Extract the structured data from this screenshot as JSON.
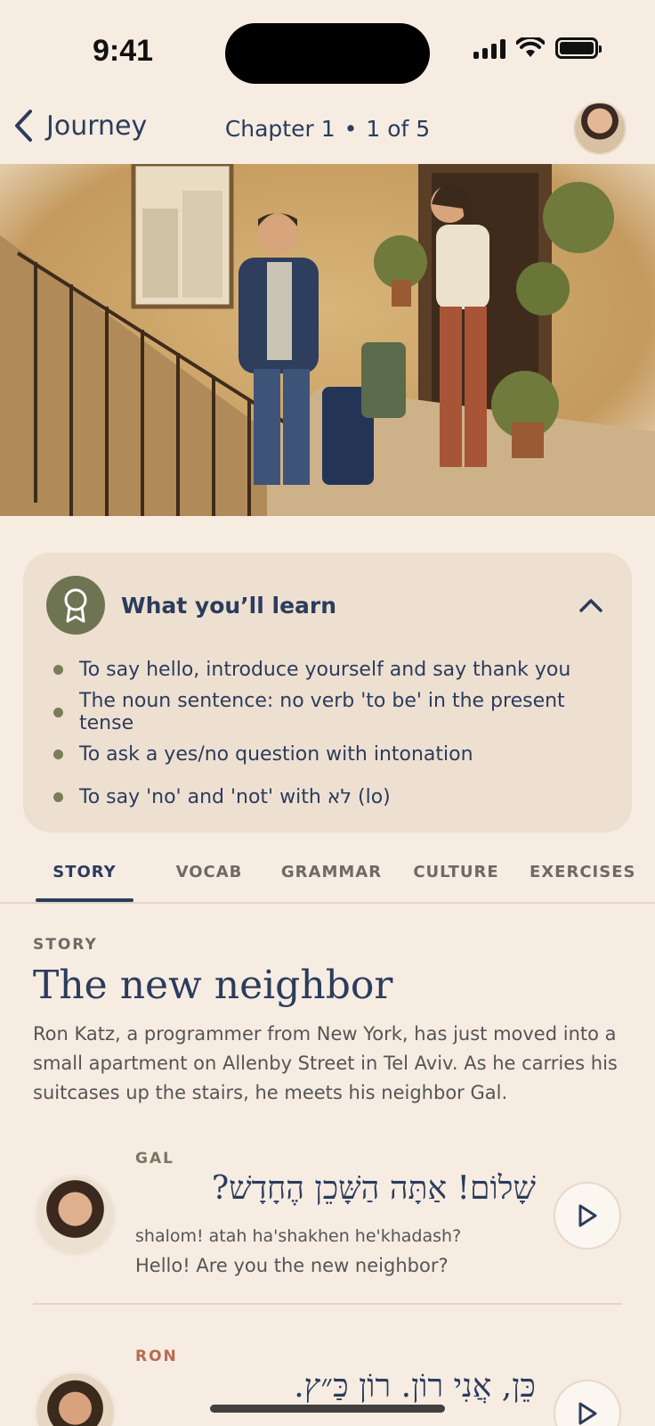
{
  "status_bar": {
    "time": "9:41"
  },
  "nav": {
    "back_label": "Journey",
    "chapter": "Chapter 1",
    "separator": "•",
    "progress": "1 of 5"
  },
  "learn": {
    "title": "What you’ll learn",
    "items": [
      "To say hello, introduce yourself and say thank you",
      "The noun sentence: no verb 'to be' in the present tense",
      "To ask a yes/no question with intonation",
      "To say 'no' and 'not' with לא (lo)"
    ]
  },
  "tabs": [
    "STORY",
    "VOCAB",
    "GRAMMAR",
    "CULTURE",
    "EXERCISES"
  ],
  "active_tab": "STORY",
  "story": {
    "eyebrow": "STORY",
    "title": "The new neighbor",
    "intro": "Ron Katz, a programmer from New York, has just moved into a small apartment on Allenby Street in Tel Aviv. As he carries his suitcases up the stairs, he meets his neighbor Gal."
  },
  "dialogue": [
    {
      "speaker": "GAL",
      "hebrew": "שָׁלוֹם! אַתָּה הַשָּׁכֵן הֶחָדָשׁ?",
      "transliteration": "shalom! atah ha'shakhen he'khadash?",
      "translation": "Hello! Are you the new neighbor?",
      "speaker_color": "#7b7562"
    },
    {
      "speaker": "RON",
      "hebrew": "כֵּן, אֲנִי רוֹן. רוֹן כַּ״ץ.",
      "speaker_color": "#b86a50"
    }
  ],
  "colors": {
    "accent": "#2b3c5c",
    "badge": "#6e7451",
    "background": "#f6ece2",
    "card": "#eee0d1"
  },
  "icons": [
    "chevron-left-icon",
    "award-icon",
    "chevron-up-icon",
    "play-icon"
  ]
}
